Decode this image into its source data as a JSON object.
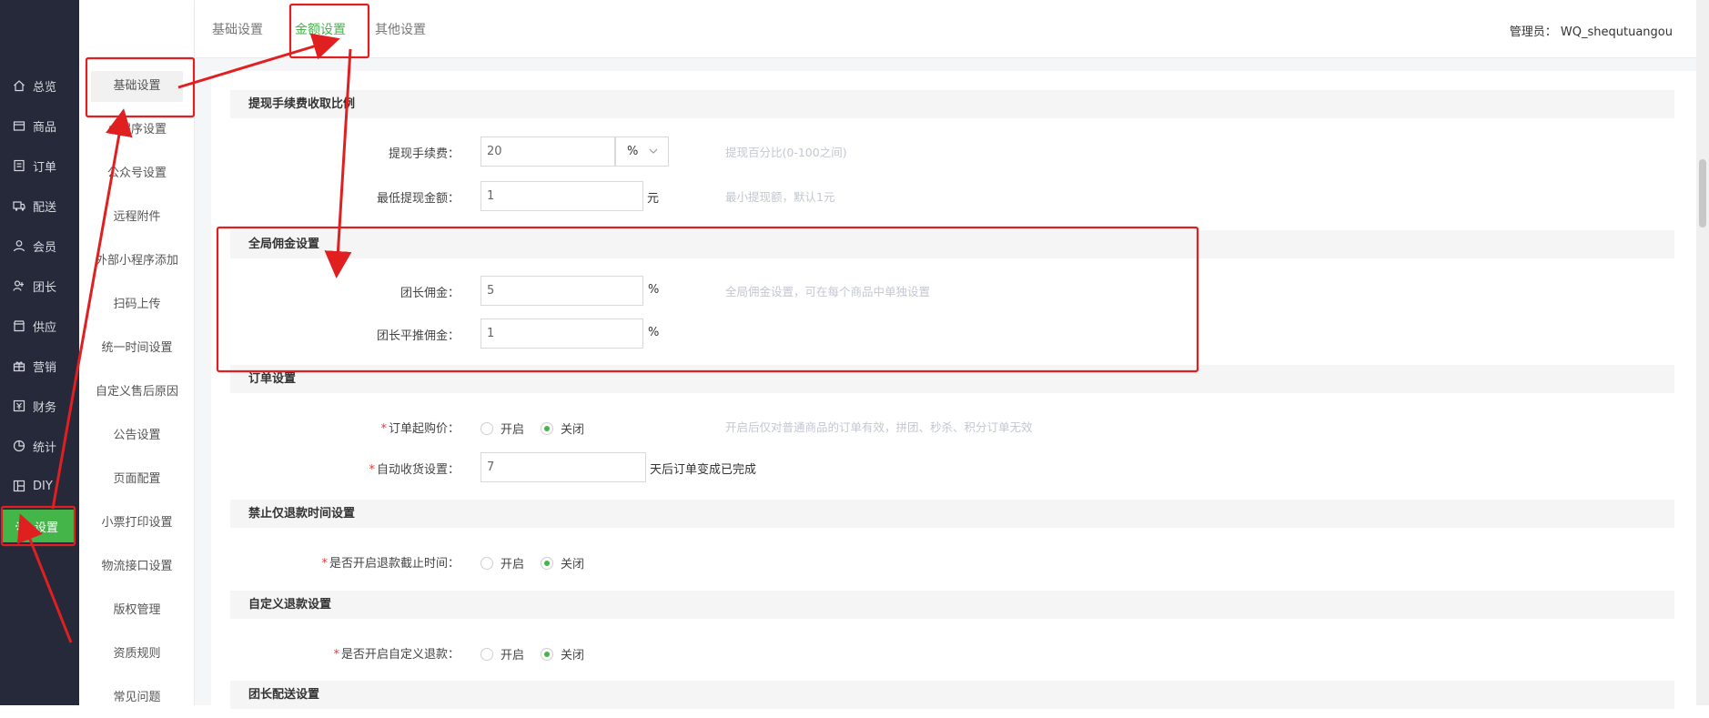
{
  "colors": {
    "accent": "#44b549",
    "sidebar_bg": "#26293a",
    "annotation": "#e02020"
  },
  "nav_primary": [
    {
      "label": "总览",
      "icon": "home-icon"
    },
    {
      "label": "商品",
      "icon": "box-icon"
    },
    {
      "label": "订单",
      "icon": "list-icon"
    },
    {
      "label": "配送",
      "icon": "truck-icon"
    },
    {
      "label": "会员",
      "icon": "user-icon"
    },
    {
      "label": "团长",
      "icon": "leader-icon"
    },
    {
      "label": "供应",
      "icon": "store-icon"
    },
    {
      "label": "营销",
      "icon": "gift-icon"
    },
    {
      "label": "财务",
      "icon": "finance-icon"
    },
    {
      "label": "统计",
      "icon": "pie-icon"
    },
    {
      "label": "DIY",
      "icon": "layout-icon"
    },
    {
      "label": "设置",
      "icon": "gear-icon",
      "active": true
    }
  ],
  "nav_secondary": [
    {
      "label": "基础设置",
      "active": true
    },
    {
      "label": "小程序设置"
    },
    {
      "label": "公众号设置"
    },
    {
      "label": "远程附件"
    },
    {
      "label": "外部小程序添加"
    },
    {
      "label": "扫码上传"
    },
    {
      "label": "统一时间设置"
    },
    {
      "label": "自定义售后原因"
    },
    {
      "label": "公告设置"
    },
    {
      "label": "页面配置"
    },
    {
      "label": "小票打印设置"
    },
    {
      "label": "物流接口设置"
    },
    {
      "label": "版权管理"
    },
    {
      "label": "资质规则"
    },
    {
      "label": "常见问题"
    }
  ],
  "tabs": [
    {
      "label": "基础设置"
    },
    {
      "label": "金额设置",
      "active": true
    },
    {
      "label": "其他设置"
    }
  ],
  "admin": "管理员： WQ_shequtuangou",
  "sections": {
    "withdraw": {
      "title": "提现手续费收取比例",
      "fee_label": "提现手续费：",
      "fee_value": "20",
      "fee_unit_select": "%",
      "fee_hint": "提现百分比(0-100之间)",
      "min_label": "最低提现金额：",
      "min_value": "1",
      "min_unit": "元",
      "min_hint": "最小提现额，默认1元"
    },
    "commission": {
      "title": "全局佣金设置",
      "leader_label": "团长佣金：",
      "leader_value": "5",
      "leader_unit": "%",
      "leader_hint": "全局佣金设置，可在每个商品中单独设置",
      "push_label": "团长平推佣金：",
      "push_value": "1",
      "push_unit": "%"
    },
    "order": {
      "title": "订单设置",
      "min_price_label": "订单起购价：",
      "opt_on": "开启",
      "opt_off": "关闭",
      "min_price_hint": "开启后仅对普通商品的订单有效，拼团、秒杀、积分订单无效",
      "auto_receive_label": "自动收货设置：",
      "auto_receive_value": "7",
      "auto_receive_unit": "天后订单变成已完成"
    },
    "refund_time": {
      "title": "禁止仅退款时间设置",
      "label": "是否开启退款截止时间：",
      "opt_on": "开启",
      "opt_off": "关闭"
    },
    "custom_refund": {
      "title": "自定义退款设置",
      "label": "是否开启自定义退款：",
      "opt_on": "开启",
      "opt_off": "关闭"
    },
    "leader_delivery": {
      "title": "团长配送设置"
    }
  }
}
